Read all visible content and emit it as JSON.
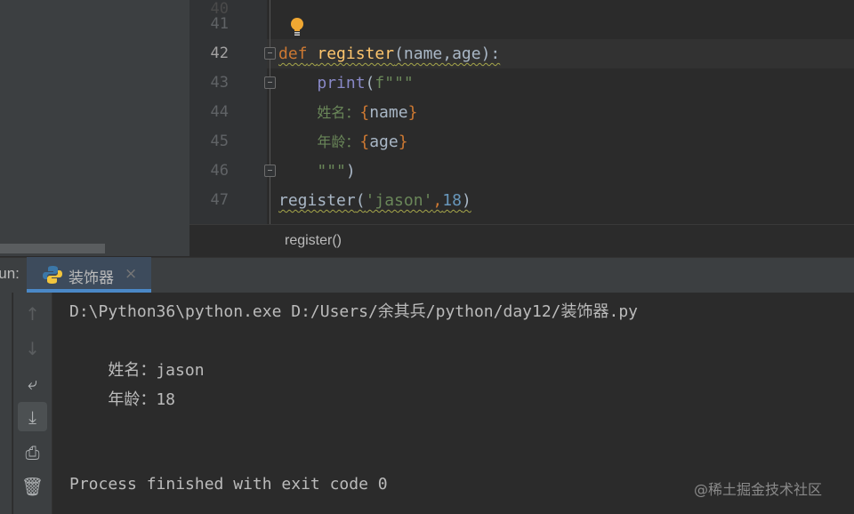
{
  "editor": {
    "lines": [
      {
        "num": "41"
      },
      {
        "num": "42",
        "parts": {
          "kw": "def",
          "fn": "register",
          "rest": "(name,age):"
        }
      },
      {
        "num": "43",
        "parts": {
          "bi": "print",
          "paren": "(",
          "st": "f\"\"\""
        }
      },
      {
        "num": "44",
        "parts": {
          "label": "姓名：",
          "b1": "{",
          "var": "name",
          "b2": "}"
        }
      },
      {
        "num": "45",
        "parts": {
          "label": "年龄：",
          "b1": "{",
          "var": "age",
          "b2": "}"
        }
      },
      {
        "num": "46",
        "parts": {
          "st": "\"\"\"",
          "paren": ")"
        }
      },
      {
        "num": "47",
        "parts": {
          "fn": "register",
          "p1": "(",
          "st": "'jason'",
          "comma": ",",
          "num": "18",
          "p2": ")"
        }
      }
    ],
    "breadcrumb": "register()"
  },
  "run": {
    "label": "Run:",
    "tab_title": "装饰器",
    "close": "×",
    "console": [
      "D:\\Python36\\python.exe D:/Users/余其兵/python/day12/装饰器.py",
      "    姓名：jason",
      "    年龄：18",
      "Process finished with exit code 0"
    ],
    "toolbar": [
      "arrow-up-icon",
      "arrow-down-icon",
      "soft-wrap-icon",
      "scroll-to-end-icon",
      "print-icon",
      "trash-icon"
    ]
  },
  "watermark": "@稀土掘金技术社区",
  "colors": {
    "accent": "#4a88c7",
    "keyword": "#cc7832",
    "function": "#ffc66d",
    "string": "#6a8759",
    "number": "#6897bb"
  }
}
